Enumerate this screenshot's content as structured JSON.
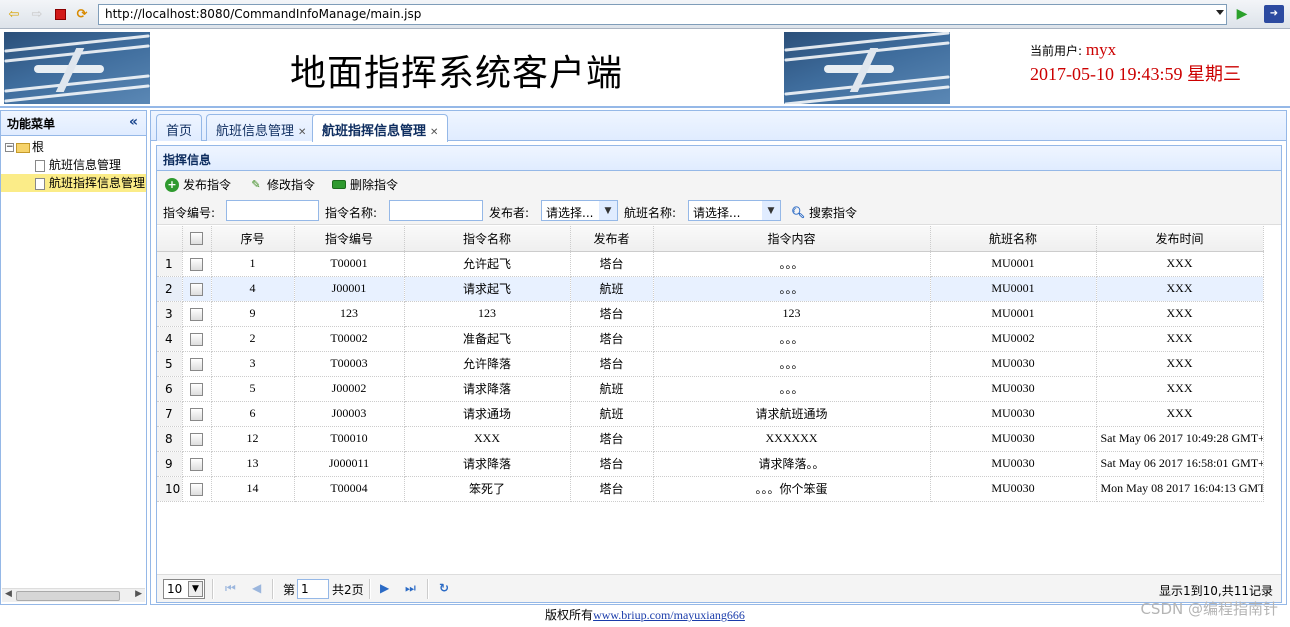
{
  "browser": {
    "url": "http://localhost:8080/CommandInfoManage/main.jsp"
  },
  "header": {
    "title": "地面指挥系统客户端",
    "user_label": "当前用户:",
    "user_name": "myx",
    "datetime": "2017-05-10 19:43:59 星期三"
  },
  "menu": {
    "title": "功能菜单",
    "root": "根",
    "items": [
      "航班信息管理",
      "航班指挥信息管理"
    ],
    "selected_index": 1
  },
  "tabs": [
    {
      "label": "首页",
      "closable": false
    },
    {
      "label": "航班信息管理",
      "closable": true
    },
    {
      "label": "航班指挥信息管理",
      "closable": true,
      "active": true
    }
  ],
  "panel": {
    "title": "指挥信息",
    "actions": [
      "发布指令",
      "修改指令",
      "删除指令"
    ],
    "filters": {
      "code_label": "指令编号:",
      "name_label": "指令名称:",
      "publisher_label": "发布者:",
      "publisher_placeholder": "请选择...",
      "flight_label": "航班名称:",
      "flight_placeholder": "请选择...",
      "search_label": "搜索指令"
    }
  },
  "grid": {
    "columns": [
      "序号",
      "指令编号",
      "指令名称",
      "发布者",
      "指令内容",
      "航班名称",
      "发布时间"
    ],
    "rows": [
      {
        "rn": "1",
        "seq": "1",
        "code": "T00001",
        "name": "允许起飞",
        "pub": "塔台",
        "content": "。。。",
        "flight": "MU0001",
        "time": "XXX"
      },
      {
        "rn": "2",
        "seq": "4",
        "code": "J00001",
        "name": "请求起飞",
        "pub": "航班",
        "content": "。。。",
        "flight": "MU0001",
        "time": "XXX"
      },
      {
        "rn": "3",
        "seq": "9",
        "code": "123",
        "name": "123",
        "pub": "塔台",
        "content": "123",
        "flight": "MU0001",
        "time": "XXX"
      },
      {
        "rn": "4",
        "seq": "2",
        "code": "T00002",
        "name": "准备起飞",
        "pub": "塔台",
        "content": "。。。",
        "flight": "MU0002",
        "time": "XXX"
      },
      {
        "rn": "5",
        "seq": "3",
        "code": "T00003",
        "name": "允许降落",
        "pub": "塔台",
        "content": "。。。",
        "flight": "MU0030",
        "time": "XXX"
      },
      {
        "rn": "6",
        "seq": "5",
        "code": "J00002",
        "name": "请求降落",
        "pub": "航班",
        "content": "。。。",
        "flight": "MU0030",
        "time": "XXX"
      },
      {
        "rn": "7",
        "seq": "6",
        "code": "J00003",
        "name": "请求通场",
        "pub": "航班",
        "content": "请求航班通场",
        "flight": "MU0030",
        "time": "XXX"
      },
      {
        "rn": "8",
        "seq": "12",
        "code": "T00010",
        "name": "XXX",
        "pub": "塔台",
        "content": "XXXXXX",
        "flight": "MU0030",
        "time": "Sat May 06 2017 10:49:28 GMT+"
      },
      {
        "rn": "9",
        "seq": "13",
        "code": "J000011",
        "name": "请求降落",
        "pub": "塔台",
        "content": "请求降落。。",
        "flight": "MU0030",
        "time": "Sat May 06 2017 16:58:01 GMT+"
      },
      {
        "rn": "10",
        "seq": "14",
        "code": "T00004",
        "name": "笨死了",
        "pub": "塔台",
        "content": "。。。你个笨蛋",
        "flight": "MU0030",
        "time": "Mon May 08 2017 16:04:13 GMT"
      }
    ],
    "highlight_row": 1
  },
  "pager": {
    "page_size": "10",
    "page_prefix": "第",
    "page_value": "1",
    "page_total": "共2页",
    "summary": "显示1到10,共11记录"
  },
  "footer": {
    "prefix": "版权所有",
    "link": "www.briup.com/mayuxiang666"
  },
  "watermark": "CSDN @编程指南针"
}
